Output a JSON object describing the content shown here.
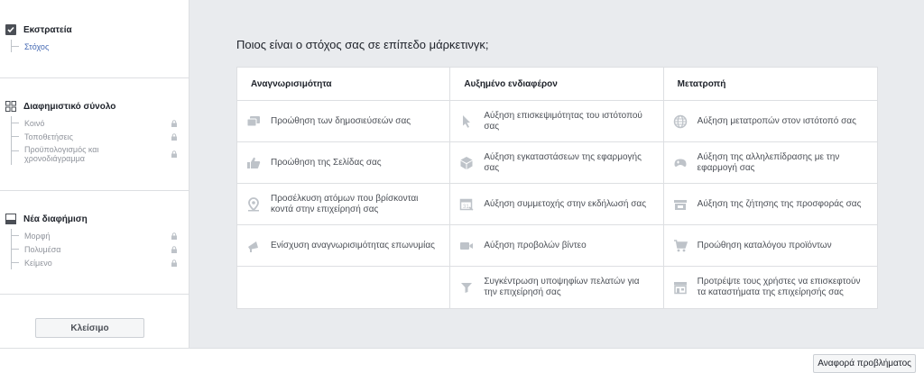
{
  "sidebar": {
    "campaign": {
      "title": "Εκστρατεία",
      "items": [
        {
          "label": "Στόχος",
          "active": true
        }
      ]
    },
    "adset": {
      "title": "Διαφημιστικό σύνολο",
      "items": [
        {
          "label": "Κοινό",
          "locked": true
        },
        {
          "label": "Τοποθετήσεις",
          "locked": true
        },
        {
          "label": "Προϋπολογισμός και χρονοδιάγραμμα",
          "locked": true
        }
      ]
    },
    "ad": {
      "title": "Νέα διαφήμιση",
      "items": [
        {
          "label": "Μορφή",
          "locked": true
        },
        {
          "label": "Πολυμέσα",
          "locked": true
        },
        {
          "label": "Κείμενο",
          "locked": true
        }
      ]
    },
    "close_label": "Κλείσιμο"
  },
  "main": {
    "question": "Ποιος είναι ο στόχος σας σε επίπεδο μάρκετινγκ;",
    "columns": [
      {
        "header": "Αναγνωρισιμότητα",
        "options": [
          {
            "label": "Προώθηση των δημοσιεύσεών σας",
            "icon": "post-boost-icon"
          },
          {
            "label": "Προώθηση της Σελίδας σας",
            "icon": "like-icon"
          },
          {
            "label": "Προσέλκυση ατόμων που βρίσκονται κοντά στην επιχείρησή σας",
            "icon": "location-pin-icon"
          },
          {
            "label": "Ενίσχυση αναγνωρισιμότητας επωνυμίας",
            "icon": "megaphone-icon"
          }
        ]
      },
      {
        "header": "Αυξημένο ενδιαφέρον",
        "options": [
          {
            "label": "Αύξηση επισκεψιμότητας του ιστότοπού σας",
            "icon": "cursor-icon"
          },
          {
            "label": "Αύξηση εγκαταστάσεων της εφαρμογής σας",
            "icon": "app-box-icon"
          },
          {
            "label": "Αύξηση συμμετοχής στην εκδήλωσή σας",
            "icon": "calendar-icon"
          },
          {
            "label": "Αύξηση προβολών βίντεο",
            "icon": "video-camera-icon"
          },
          {
            "label": "Συγκέντρωση υποψηφίων πελατών για την επιχείρησή σας",
            "icon": "funnel-icon"
          }
        ]
      },
      {
        "header": "Μετατροπή",
        "options": [
          {
            "label": "Αύξηση μετατροπών στον ιστότοπό σας",
            "icon": "globe-icon"
          },
          {
            "label": "Αύξηση της αλληλεπίδρασης με την εφαρμογή σας",
            "icon": "game-controller-icon"
          },
          {
            "label": "Αύξηση της ζήτησης της προσφοράς σας",
            "icon": "offer-icon"
          },
          {
            "label": "Προώθηση καταλόγου προϊόντων",
            "icon": "shopping-cart-icon"
          },
          {
            "label": "Προτρέψτε τους χρήστες να επισκεφτούν τα καταστήματα της επιχείρησής σας",
            "icon": "storefront-icon"
          }
        ]
      }
    ]
  },
  "footer": {
    "report_label": "Αναφορά προβλήματος"
  },
  "colors": {
    "accent": "#4267b2",
    "icon": "#bec3c9",
    "border": "#dddfe2",
    "background": "#e9ebee"
  }
}
